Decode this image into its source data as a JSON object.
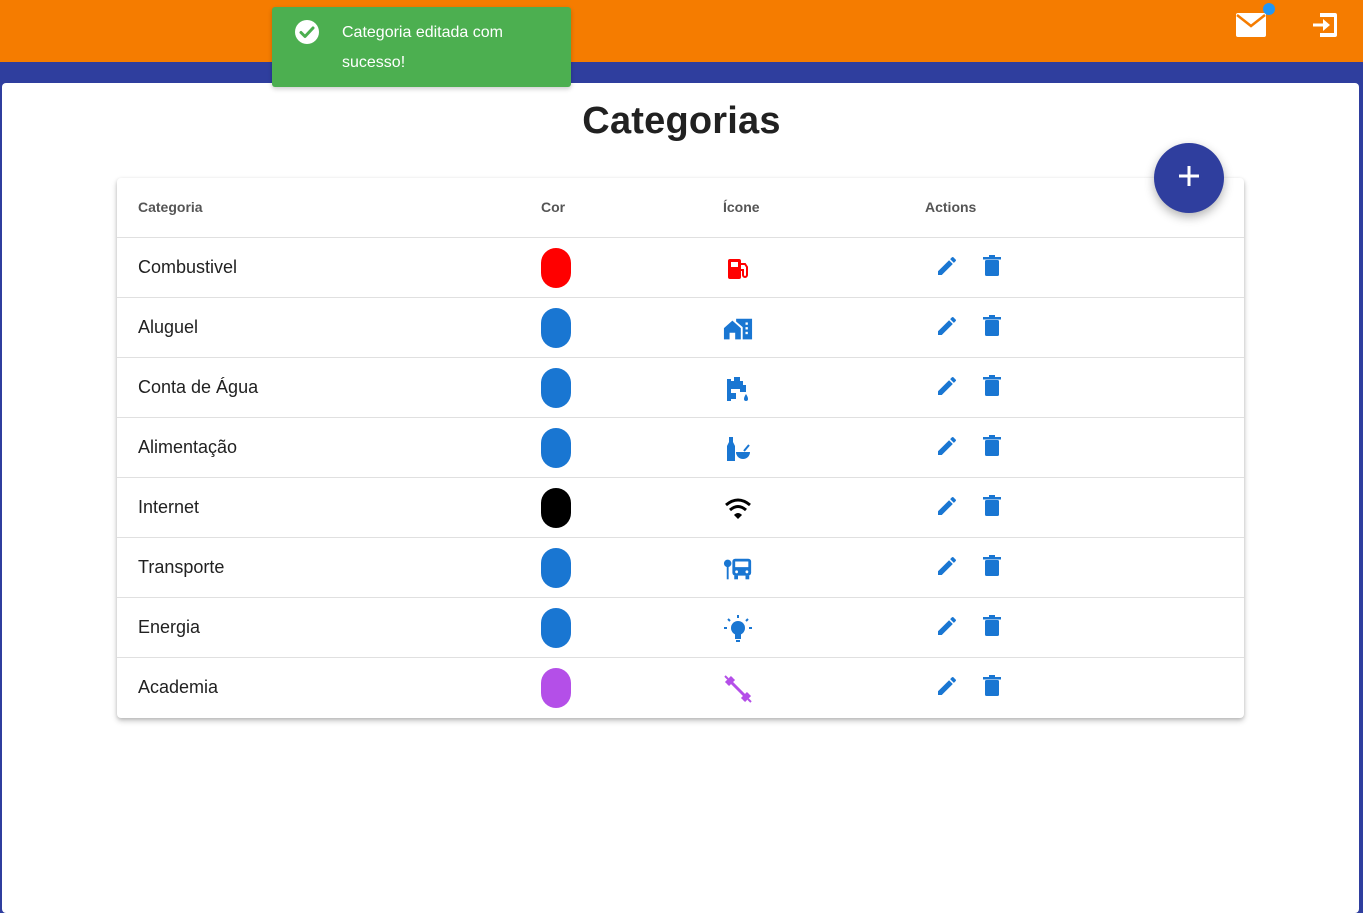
{
  "toast": {
    "message": "Categoria editada com sucesso!"
  },
  "header": {
    "icons": [
      "mail-icon",
      "logout-icon"
    ]
  },
  "page": {
    "title": "Categorias"
  },
  "table": {
    "columns": [
      "Categoria",
      "Cor",
      "Ícone",
      "Actions"
    ],
    "rows": [
      {
        "name": "Combustivel",
        "color": "#ff0000",
        "icon": "gas-station-icon"
      },
      {
        "name": "Aluguel",
        "color": "#1976d2",
        "icon": "home-city-icon"
      },
      {
        "name": "Conta de Água",
        "color": "#1976d2",
        "icon": "water-tap-icon"
      },
      {
        "name": "Alimentação",
        "color": "#1976d2",
        "icon": "food-bottle-bowl-icon"
      },
      {
        "name": "Internet",
        "color": "#000000",
        "icon": "wifi-icon"
      },
      {
        "name": "Transporte",
        "color": "#1976d2",
        "icon": "bus-stop-icon"
      },
      {
        "name": "Energia",
        "color": "#1976d2",
        "icon": "lightbulb-icon"
      },
      {
        "name": "Academia",
        "color": "#b44fe8",
        "icon": "dumbbell-icon"
      }
    ]
  },
  "colors": {
    "topbar": "#f57c00",
    "primary": "#2f3e9e",
    "action": "#1976d2",
    "toast": "#4caf50"
  }
}
